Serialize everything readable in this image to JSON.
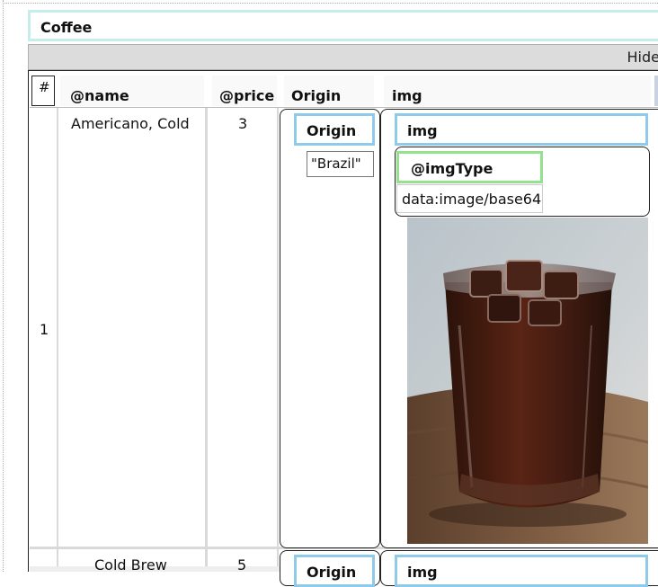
{
  "table": {
    "title": "Coffee",
    "hide_label": "Hide",
    "columns": {
      "index": "#",
      "name": "@name",
      "price": "@price",
      "origin": "Origin",
      "img": "img"
    },
    "rows": [
      {
        "index": "1",
        "name": "Americano, Cold",
        "price": "3",
        "origin_header": "Origin",
        "origin_value": "\"Brazil\"",
        "img_header": "img",
        "img_type_header": "@imgType",
        "img_type_value": "data:image/base64"
      },
      {
        "name": "Cold Brew",
        "price": "5",
        "origin_header": "Origin",
        "img_header": "img"
      }
    ]
  },
  "colors": {
    "title_border": "#c6ecec",
    "nested_header_border": "#8ecaea",
    "attr_header_border": "#94e28f",
    "hide_bar_bg": "#dcdcdc"
  }
}
